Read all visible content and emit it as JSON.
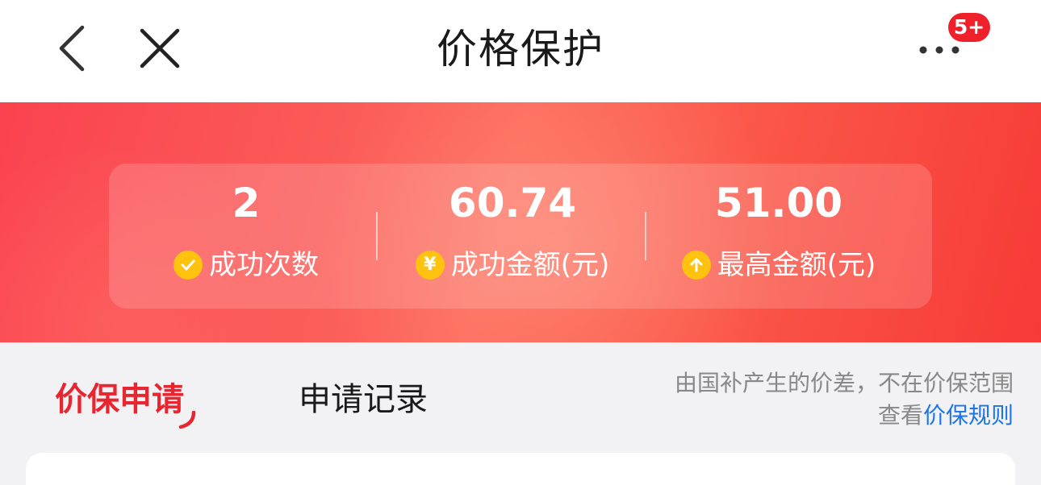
{
  "header": {
    "title": "价格保护",
    "badge": "5+"
  },
  "stats": [
    {
      "value": "2",
      "label": "成功次数",
      "icon": "check-circle-icon"
    },
    {
      "value": "60.74",
      "label": "成功金额(元)",
      "icon": "yen-circle-icon",
      "icon_glyph": "¥"
    },
    {
      "value": "51.00",
      "label": "最高金额(元)",
      "icon": "arrow-up-circle-icon",
      "icon_glyph": "↑"
    }
  ],
  "tabs": {
    "apply": "价保申请",
    "record": "申请记录"
  },
  "notice": {
    "line1": "由国补产生的价差，不在价保范围",
    "line2_prefix": "查看",
    "rule_link": "价保规则"
  },
  "colors": {
    "accent_red": "#e8262f",
    "badge_red": "#f0202b",
    "icon_yellow": "#ffc20e",
    "link_blue": "#1c74e8"
  }
}
